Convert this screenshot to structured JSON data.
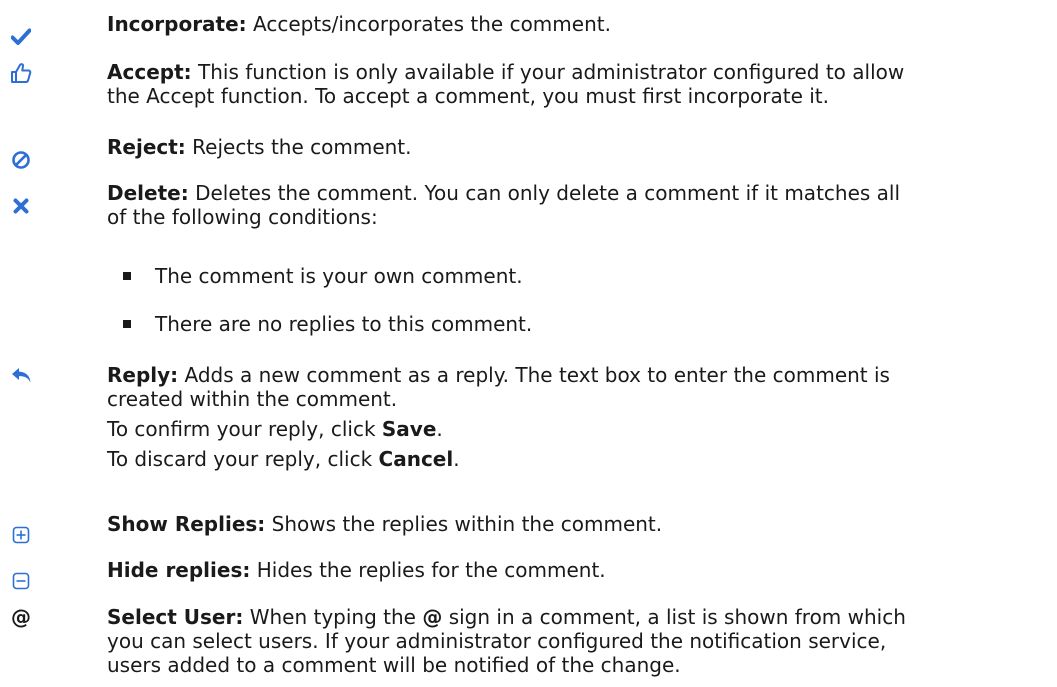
{
  "items": {
    "incorporate": {
      "icon": "checkmark-icon",
      "term": "Incorporate:",
      "desc": "Accepts/incorporates the comment."
    },
    "accept": {
      "icon": "thumbs-up-icon",
      "term": "Accept:",
      "line1": "This function is only available if your administrator configured to allow",
      "line2": "the Accept function. To accept a comment, you must first incorporate it."
    },
    "reject": {
      "icon": "prohibited-icon",
      "term": "Reject:",
      "desc": "Rejects the comment."
    },
    "delete": {
      "icon": "x-icon",
      "term": "Delete:",
      "line1": "Deletes the comment. You can only delete a comment if it matches all",
      "line2": "of the following conditions:",
      "bullets": [
        "The comment is your own comment.",
        "There are no replies to this comment."
      ]
    },
    "reply": {
      "icon": "reply-arrow-icon",
      "term": "Reply:",
      "line1": "Adds a new comment as a reply. The text box to enter the comment is",
      "line2": "created within the comment.",
      "confirm_prefix": "To confirm your reply, click",
      "confirm_action": "Save",
      "discard_prefix": "To discard your reply, click",
      "discard_action": "Cancel",
      "period": "."
    },
    "show_replies": {
      "icon": "plus-box-icon",
      "term": "Show Replies:",
      "desc": "Shows the replies within the comment."
    },
    "hide_replies": {
      "icon": "minus-box-icon",
      "term": "Hide replies:",
      "desc": "Hides the replies for the comment."
    },
    "select_user": {
      "icon_text": "@",
      "term": "Select User:",
      "line1_prefix": "When typing the",
      "line1_at": "@",
      "line1_suffix": "sign in a comment, a list is shown from which",
      "line2": "you can select users. If your administrator configured the notification service,",
      "line3": "users added to a comment will be notified of the change."
    }
  },
  "colors": {
    "icon_blue": "#2e6fd6",
    "text": "#1a1a1a"
  }
}
